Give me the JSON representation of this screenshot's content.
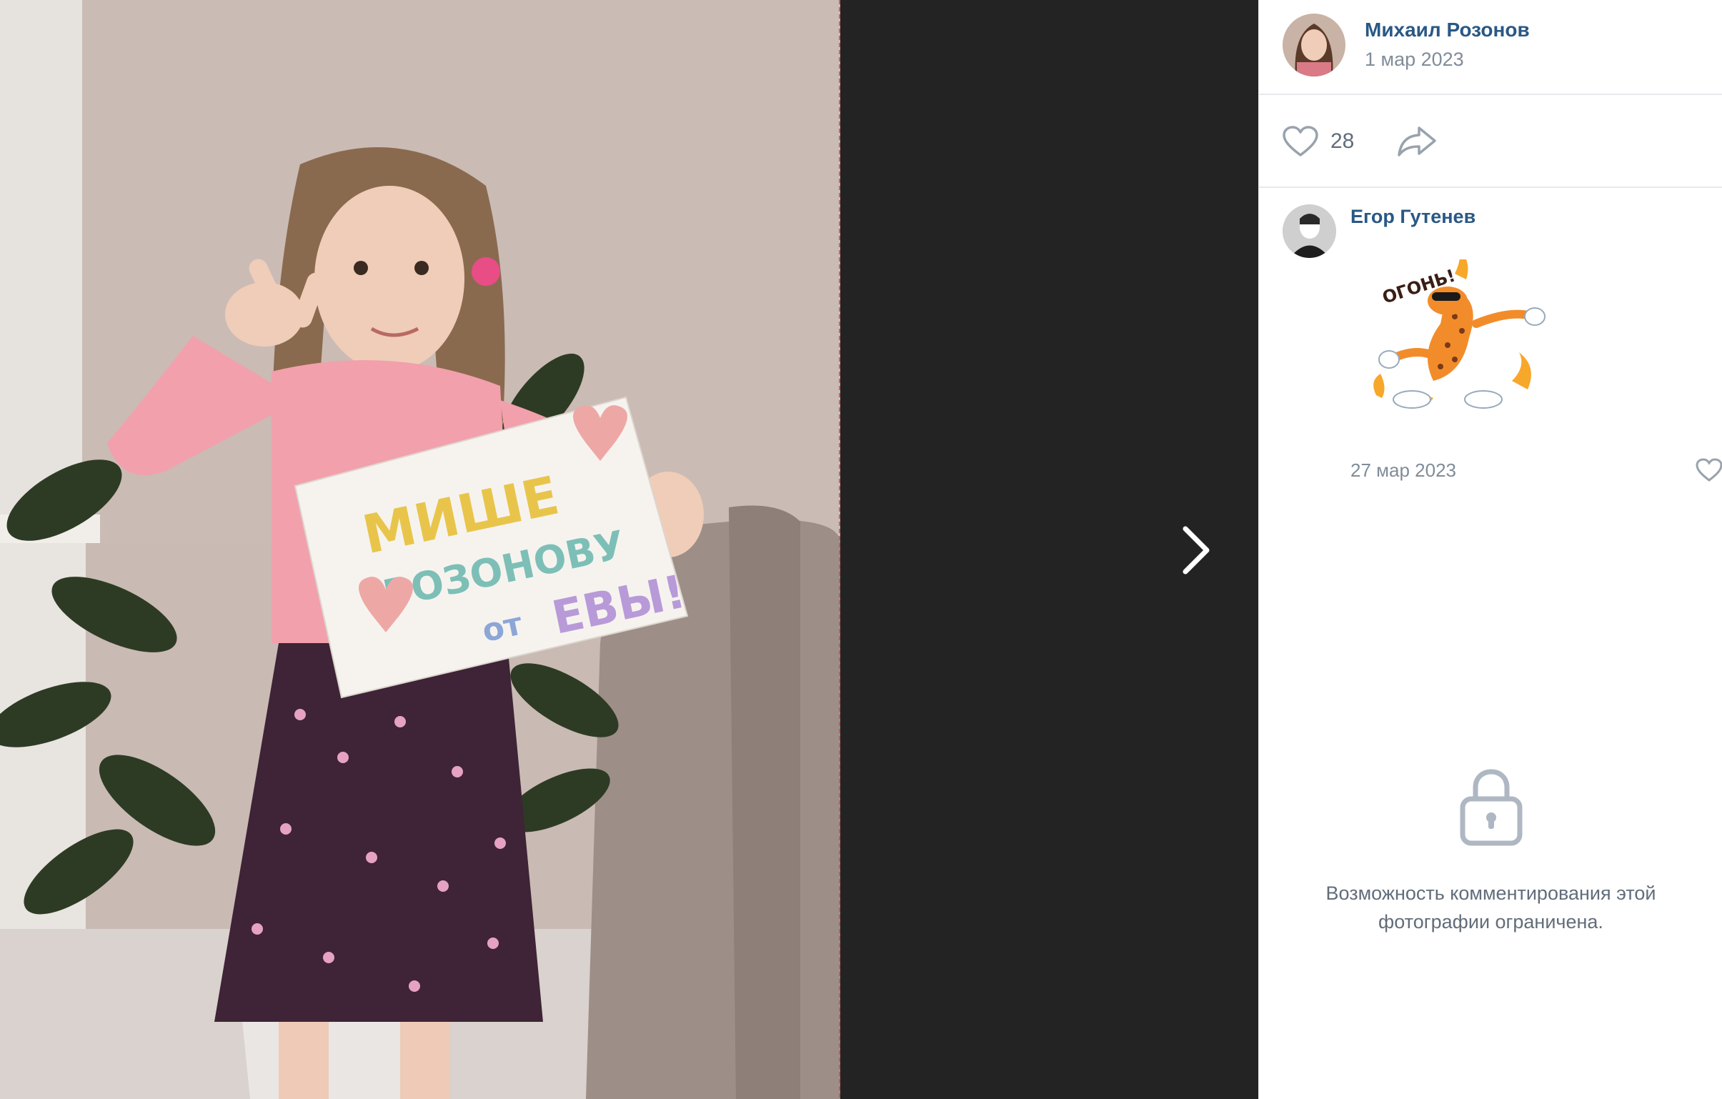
{
  "post": {
    "author_name": "Михаил Розонов",
    "date": "1 мар 2023",
    "likes": "28"
  },
  "photo": {
    "sign_line1": "МИШЕ",
    "sign_line2": "РОЗОНОВУ",
    "sign_line3": "от",
    "sign_line4": "ЕВЫ!"
  },
  "comment": {
    "author_name": "Егор Гутенев",
    "sticker_text": "ОГОНЬ!",
    "date": "27 мар 2023"
  },
  "comments_locked": {
    "message": "Возможность комментирования этой фотографии ограничена."
  },
  "colors": {
    "link": "#2a5885",
    "muted": "#818c99",
    "viewer_bg": "#232323"
  }
}
